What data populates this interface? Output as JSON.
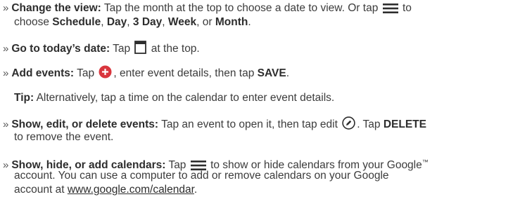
{
  "bullet_glyph": "»",
  "colors": {
    "add_icon": "#d9363e",
    "text": "#3c3c3c"
  },
  "icons": {
    "menu": "menu-icon",
    "calendar": "calendar-icon",
    "add": "add-plus-icon",
    "edit": "edit-pencil-icon"
  },
  "items": [
    {
      "heading": "Change the view:",
      "t1": "Tap the month at the top to choose a date to view. Or tap",
      "t2": "to",
      "t3": "choose",
      "opt1": "Schedule",
      "sep1": ",",
      "opt2": "Day",
      "sep2": ",",
      "opt3": "3 Day",
      "sep3": ",",
      "opt4": "Week",
      "sep4": ", or",
      "opt5": "Month",
      "end": "."
    },
    {
      "heading": "Go to today’s date:",
      "t1": "Tap",
      "t2": "at the top."
    },
    {
      "heading": "Add events:",
      "t1": "Tap",
      "t2": ", enter event details, then tap",
      "save": "SAVE",
      "end": "."
    },
    {
      "tip_label": "Tip:",
      "tip_text": "Alternatively, tap a time on the calendar to enter event details."
    },
    {
      "heading": "Show, edit, or delete events:",
      "t1": "Tap an event to open it, then tap edit",
      "t2": ". Tap",
      "delete": "DELETE",
      "t3": "to remove the event."
    },
    {
      "heading": "Show, hide, or add calendars:",
      "t1": "Tap",
      "t2": "to show or hide calendars from your Google",
      "tm": "™",
      "l2": "account. You can use a computer to add or remove calendars on your Google",
      "l3a": "account at",
      "link": "www.google.com/calendar",
      "l3b": "."
    }
  ]
}
